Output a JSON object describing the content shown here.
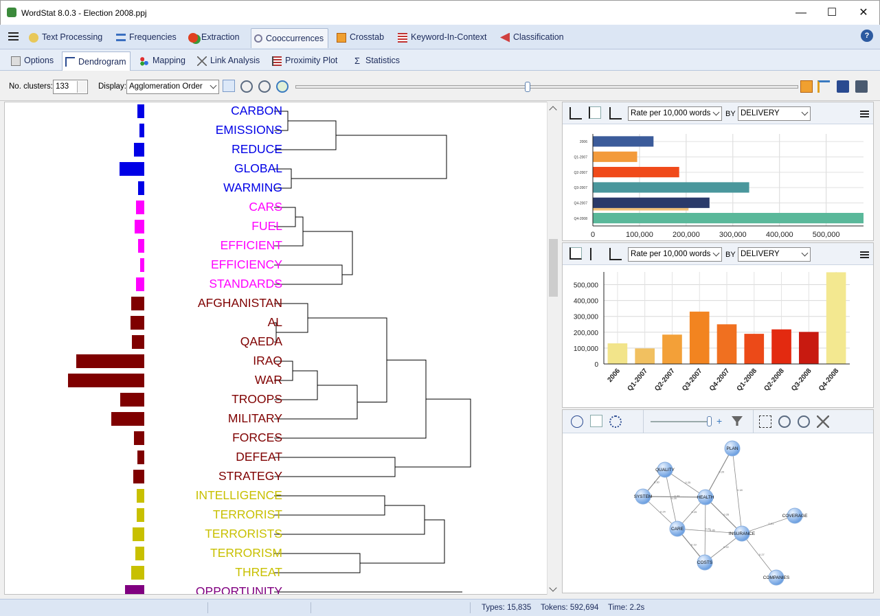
{
  "app": {
    "title": "WordStat 8.0.3 - Election 2008.ppj"
  },
  "window_controls": {
    "minimize": "—",
    "maximize": "☐",
    "close": "✕"
  },
  "menu_tabs": [
    "Text Processing",
    "Frequencies",
    "Extraction",
    "Cooccurrences",
    "Crosstab",
    "Keyword-In-Context",
    "Classification"
  ],
  "sub_tabs": [
    "Options",
    "Dendrogram",
    "Mapping",
    "Link Analysis",
    "Proximity Plot",
    "Statistics"
  ],
  "toolbar": {
    "clusters_label": "No. clusters:",
    "clusters_value": "133",
    "display_label": "Display:",
    "display_value": "Agglomeration Order"
  },
  "dendrogram": {
    "words": [
      {
        "text": "CARBON",
        "color": "#0000e6",
        "freq": 10
      },
      {
        "text": "EMISSIONS",
        "color": "#0000e6",
        "freq": 7
      },
      {
        "text": "REDUCE",
        "color": "#0000e6",
        "freq": 15
      },
      {
        "text": "GLOBAL",
        "color": "#0000e6",
        "freq": 36
      },
      {
        "text": "WARMING",
        "color": "#0000e6",
        "freq": 9
      },
      {
        "text": "CARS",
        "color": "#ff00ff",
        "freq": 12
      },
      {
        "text": "FUEL",
        "color": "#ff00ff",
        "freq": 14
      },
      {
        "text": "EFFICIENT",
        "color": "#ff00ff",
        "freq": 9
      },
      {
        "text": "EFFICIENCY",
        "color": "#ff00ff",
        "freq": 6
      },
      {
        "text": "STANDARDS",
        "color": "#ff00ff",
        "freq": 12
      },
      {
        "text": "AFGHANISTAN",
        "color": "#7f0000",
        "freq": 19
      },
      {
        "text": "AL",
        "color": "#7f0000",
        "freq": 20
      },
      {
        "text": "QAEDA",
        "color": "#7f0000",
        "freq": 18
      },
      {
        "text": "IRAQ",
        "color": "#7f0000",
        "freq": 99
      },
      {
        "text": "WAR",
        "color": "#7f0000",
        "freq": 111
      },
      {
        "text": "TROOPS",
        "color": "#7f0000",
        "freq": 35
      },
      {
        "text": "MILITARY",
        "color": "#7f0000",
        "freq": 48
      },
      {
        "text": "FORCES",
        "color": "#7f0000",
        "freq": 15
      },
      {
        "text": "DEFEAT",
        "color": "#7f0000",
        "freq": 10
      },
      {
        "text": "STRATEGY",
        "color": "#7f0000",
        "freq": 16
      },
      {
        "text": "INTELLIGENCE",
        "color": "#c8c000",
        "freq": 11
      },
      {
        "text": "TERRORIST",
        "color": "#c8c000",
        "freq": 11
      },
      {
        "text": "TERRORISTS",
        "color": "#c8c000",
        "freq": 17
      },
      {
        "text": "TERRORISM",
        "color": "#c8c000",
        "freq": 13
      },
      {
        "text": "THREAT",
        "color": "#c8c000",
        "freq": 19
      },
      {
        "text": "OPPORTUNITY",
        "color": "#800080",
        "freq": 28
      }
    ]
  },
  "chart_panel_top": {
    "measure_value": "Rate per 10,000 words",
    "by_label": "BY",
    "by_value": "DELIVERY"
  },
  "chart_panel_mid": {
    "measure_value": "Rate per 10,000 words",
    "by_label": "BY",
    "by_value": "DELIVERY"
  },
  "chart_data": [
    {
      "type": "bar",
      "orientation": "horizontal",
      "categories": [
        "2006",
        "Q1-2007",
        "Q2-2007",
        "Q3-2007",
        "Q4-2007",
        "Q4-2008"
      ],
      "series": [
        {
          "values": [
            130000,
            95000,
            185000,
            335000,
            250000,
            580000
          ]
        },
        {
          "values": [
            null,
            null,
            null,
            null,
            205000,
            null
          ]
        }
      ],
      "colors": [
        "#3b5b9a",
        "#f39a3a",
        "#f04a1a",
        "#4a979c",
        "#2a3a6a",
        "#5ab89a"
      ],
      "overlay_color": "#f1c27a",
      "xticks": [
        "0",
        "100,000",
        "200,000",
        "300,000",
        "400,000",
        "500,000"
      ],
      "xlim": [
        0,
        580000
      ],
      "grid": true
    },
    {
      "type": "bar",
      "categories": [
        "2006",
        "Q1-2007",
        "Q2-2007",
        "Q3-2007",
        "Q4-2007",
        "Q1-2008",
        "Q2-2008",
        "Q3-2008",
        "Q4-2008"
      ],
      "values": [
        130000,
        98000,
        185000,
        330000,
        250000,
        190000,
        218000,
        202000,
        578000
      ],
      "colors": [
        "#f2e48a",
        "#f1c060",
        "#f3a038",
        "#f28420",
        "#f07020",
        "#ec4a18",
        "#e32a10",
        "#c81a10",
        "#f3e890"
      ],
      "yticks": [
        "0",
        "100,000",
        "200,000",
        "300,000",
        "400,000",
        "500,000"
      ],
      "ylim": [
        0,
        580000
      ],
      "grid": true
    }
  ],
  "network": {
    "nodes": [
      {
        "label": "PLAN"
      },
      {
        "label": "QUALITY"
      },
      {
        "label": "SYSTEM"
      },
      {
        "label": "HEALTH"
      },
      {
        "label": "COVERAGE"
      },
      {
        "label": "CARE"
      },
      {
        "label": "INSURANCE"
      },
      {
        "label": "COSTS"
      },
      {
        "label": "COMPANIES"
      }
    ],
    "edge_values": [
      "0.20",
      "0.25",
      "0.28",
      "0.33",
      "0.24",
      "0.29",
      "0.26",
      "0.21",
      "0.35",
      "0.19",
      "0.22",
      "0.27",
      "0.30",
      "0.23",
      "0.18"
    ]
  },
  "status": {
    "types": "Types: 15,835",
    "tokens": "Tokens: 592,694",
    "time": "Time: 2.2s"
  }
}
